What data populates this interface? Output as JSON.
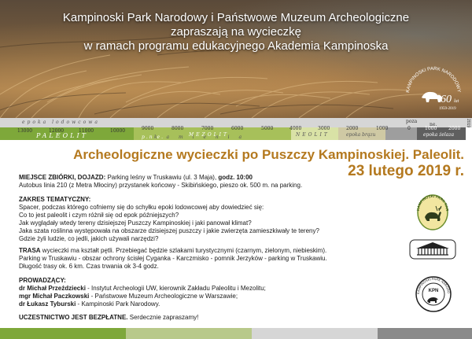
{
  "header": {
    "lines": [
      "Kampinoski Park Narodowy i Państwowe Muzeum Archeologiczne",
      "zapraszają na wycieczkę",
      "w ramach programu edukacyjnego Akademia Kampinoska"
    ],
    "badge": {
      "ring_text": "KAMPINOSKI PARK NARODOWY",
      "number": "60",
      "suffix": "lat",
      "years": "1959-2019"
    }
  },
  "timeline": {
    "top_labels": [
      "epoka lodowcowa",
      "poza",
      "ne."
    ],
    "dates": [
      "13000",
      "12000",
      "11000",
      "10000",
      "9000",
      "8000",
      "7000",
      "6000",
      "5000",
      "4000",
      "3000",
      "2000",
      "1000",
      "0",
      "1000",
      "2000"
    ],
    "eras": [
      "PALEOLIT",
      "MEZOLIT",
      "NEOLIT",
      "epoka brązu",
      "epoka żelaza"
    ],
    "subtext": "p.n.e.",
    "km_text": "k a m i e n i a",
    "side_text": "2019",
    "colors": {
      "paleolit": "#7ea83a",
      "mezolit": "#a7c05a",
      "neolit": "#d9e2a6",
      "bronze": "#cfc9a4",
      "iron": "#5f5f5f"
    }
  },
  "title": {
    "line1": "Archeologiczne wycieczki po Puszczy Kampinoskiej. Paleolit.",
    "line2": "23 lutego 2019 r.",
    "color": "#b4791f"
  },
  "meeting": {
    "label": "MIEJSCE ZBIÓRKI, DOJAZD:",
    "text1": " Parking leśny w Truskawiu (ul. 3 Maja), ",
    "time": "godz. 10:00",
    "line2": "Autobus linia 210 (z Metra Młociny) przystanek końcowy - Skibińskiego, pieszo ok. 500 m. na parking."
  },
  "scope": {
    "label": "ZAKRES TEMATYCZNY:",
    "lines": [
      "Spacer, podczas którego cofniemy się do schyłku epoki lodowcowej aby dowiedzieć się:",
      "Co to jest paleolit i czym różnił się od epok późniejszych?",
      "Jak wyglądały wtedy tereny dzisiejszej Puszczy Kampinoskiej i jaki panował klimat?",
      "Jaka szata roślinna występowała na obszarze dzisiejszej puszczy i jakie zwierzęta zamieszkiwały te tereny?",
      "Gdzie żyli ludzie, co jedli, jakich używali narzędzi?"
    ]
  },
  "route": {
    "label": "TRASA",
    "text1": " wycieczki ma kształt pętli. Przebiegać będzie szlakami turystycznymi (czarnym, zielonym, niebieskim).",
    "line2": "Parking w Truskawiu - obszar ochrony ścisłej Cyganka - Karczmisko - pomnik Jerzyków - parking w Truskawiu.",
    "line3": "Długość trasy ok. 6 km. Czas trwania ok 3-4 godz."
  },
  "leaders": {
    "label": "PROWADZĄCY:",
    "items": [
      {
        "name": "dr Michał Przeździecki",
        "role": " - Instytut Archeologii UW, kierownik Zakładu Paleolitu i Mezolitu;"
      },
      {
        "name": "mgr Michał Paczkowski",
        "role": " - Państwowe Muzeum Archeologiczne w Warszawie;"
      },
      {
        "name": "dr Łukasz Tyburski",
        "role": " - Kampinoski Park Narodowy."
      }
    ]
  },
  "participation": {
    "label": "UCZESTNICTWO JEST BEZPŁATNE.",
    "text": "  Serdecznie zapraszamy!"
  },
  "logos": {
    "kpn1_ring": "KAMPINOSKI PARK NARODOWY",
    "kpn2_center": "KPN",
    "kpn2_ring": "KAMPINOSKI PARK NARODOWY"
  },
  "bottom_bar": {
    "colors": [
      "#7ea83a",
      "#b8c98a",
      "#d6d6d6",
      "#8a8a8a"
    ]
  }
}
